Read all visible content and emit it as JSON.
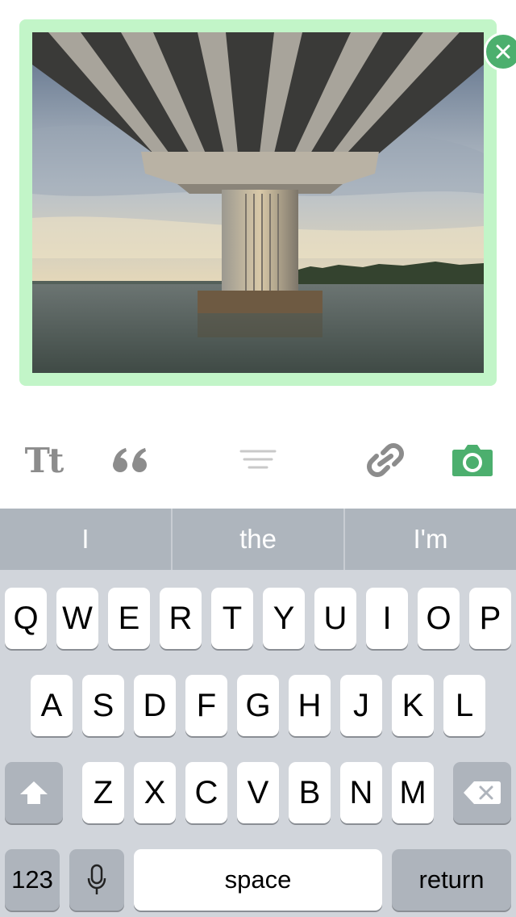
{
  "photo": {
    "remove_icon": "close-icon",
    "accent": "#4caf6e",
    "frame_color": "#c2f5c8"
  },
  "toolbar": {
    "text_label": "Tt",
    "quote_icon": "quote-icon",
    "chat_icon": "chat-lines-icon",
    "link_icon": "link-icon",
    "photo_icon": "camera-icon",
    "active_color": "#4caf6e",
    "inactive_color": "#8c8c8c"
  },
  "suggestions": [
    "I",
    "the",
    "I'm"
  ],
  "keyboard": {
    "row1": [
      "Q",
      "W",
      "E",
      "R",
      "T",
      "Y",
      "U",
      "I",
      "O",
      "P"
    ],
    "row2": [
      "A",
      "S",
      "D",
      "F",
      "G",
      "H",
      "J",
      "K",
      "L"
    ],
    "row3": [
      "Z",
      "X",
      "C",
      "V",
      "B",
      "N",
      "M"
    ],
    "numbers_label": "123",
    "space_label": "space",
    "return_label": "return",
    "shift_icon": "shift-arrow-icon",
    "delete_icon": "backspace-icon",
    "mic_icon": "microphone-icon"
  }
}
